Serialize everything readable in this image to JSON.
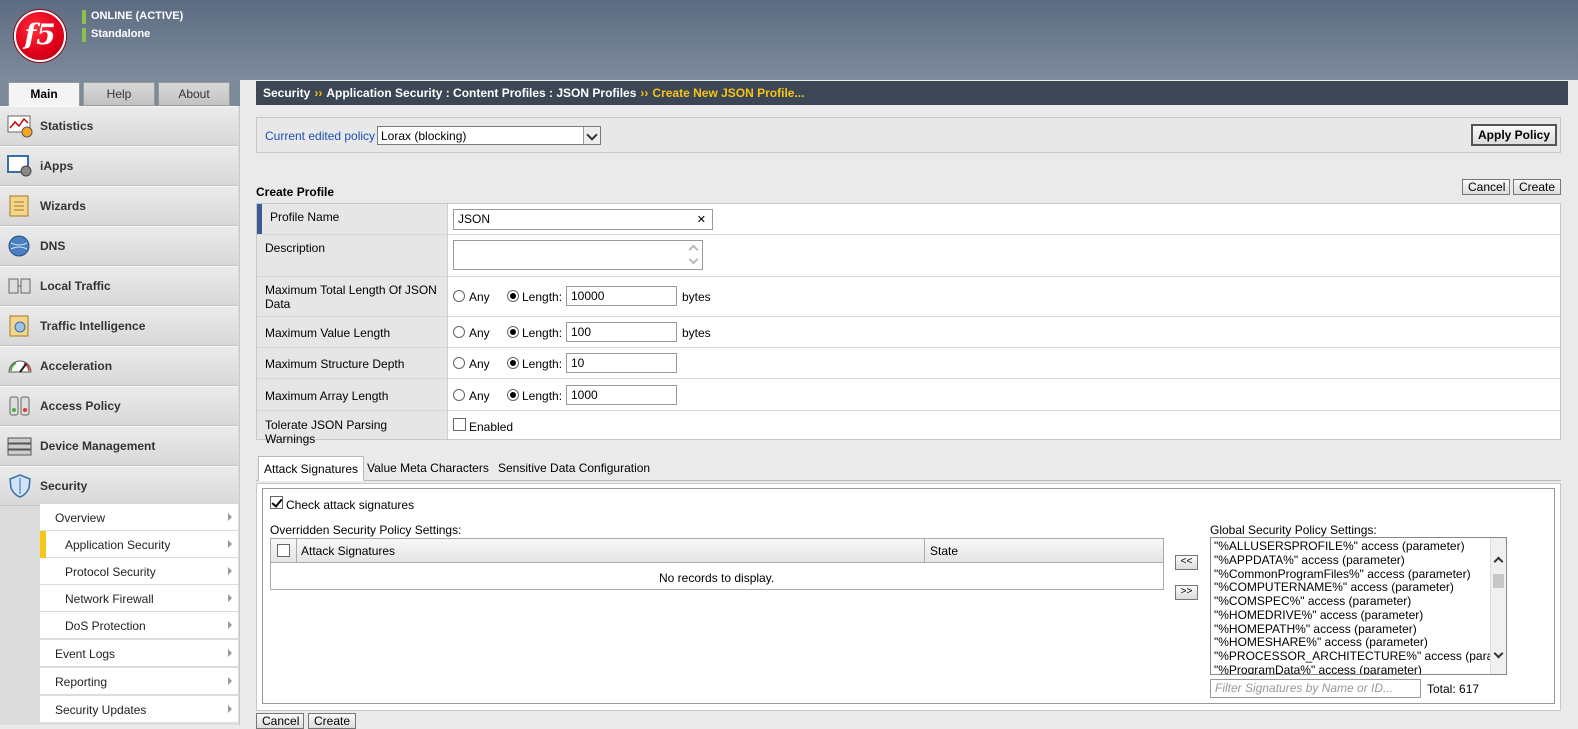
{
  "banner": {
    "logo_text": "f5",
    "status": "ONLINE (ACTIVE)",
    "mode": "Standalone"
  },
  "tabs": [
    "Main",
    "Help",
    "About"
  ],
  "nav": {
    "items": [
      {
        "label": "Statistics",
        "icon": "statistics-icon"
      },
      {
        "label": "iApps",
        "icon": "iapps-icon"
      },
      {
        "label": "Wizards",
        "icon": "wizards-icon"
      },
      {
        "label": "DNS",
        "icon": "dns-globe-icon"
      },
      {
        "label": "Local Traffic",
        "icon": "local-traffic-icon"
      },
      {
        "label": "Traffic Intelligence",
        "icon": "traffic-intelligence-icon"
      },
      {
        "label": "Acceleration",
        "icon": "acceleration-gauge-icon"
      },
      {
        "label": "Access Policy",
        "icon": "access-policy-icon"
      },
      {
        "label": "Device Management",
        "icon": "device-management-icon"
      },
      {
        "label": "Security",
        "icon": "security-shield-icon"
      }
    ],
    "security_sub": [
      {
        "label": "Overview"
      },
      {
        "label": "Application Security"
      },
      {
        "label": "Protocol Security"
      },
      {
        "label": "Network Firewall"
      },
      {
        "label": "DoS Protection"
      },
      {
        "label": "Event Logs"
      },
      {
        "label": "Reporting"
      },
      {
        "label": "Security Updates"
      }
    ]
  },
  "breadcrumb": {
    "part1": "Security",
    "sep": "››",
    "part2": "Application Security : Content Profiles : JSON Profiles",
    "current": "Create New JSON Profile..."
  },
  "policy": {
    "label": "Current edited policy",
    "selected": "Lorax (blocking)",
    "apply_label": "Apply Policy"
  },
  "form": {
    "title": "Create Profile",
    "cancel_label": "Cancel",
    "create_label": "Create",
    "profile_name_label": "Profile Name",
    "profile_name_value": "JSON",
    "clear_glyph": "✕",
    "description_label": "Description",
    "any_label": "Any",
    "length_label": "Length:",
    "bytes_label": "bytes",
    "rows": [
      {
        "label": "Maximum Total Length Of JSON Data",
        "value": "10000",
        "unit": true
      },
      {
        "label": "Maximum Value Length",
        "value": "100",
        "unit": true
      },
      {
        "label": "Maximum Structure Depth",
        "value": "10",
        "unit": false
      },
      {
        "label": "Maximum Array Length",
        "value": "1000",
        "unit": false
      }
    ],
    "tolerate_label": "Tolerate JSON Parsing Warnings",
    "enabled_label": "Enabled"
  },
  "subtabs": [
    "Attack Signatures",
    "Value Meta Characters",
    "Sensitive Data Configuration"
  ],
  "signatures": {
    "check_label": "Check attack signatures",
    "overridden_label": "Overridden Security Policy Settings:",
    "col_signatures": "Attack Signatures",
    "col_state": "State",
    "no_records": "No records to display.",
    "move_left": "<<",
    "move_right": ">>",
    "global_label": "Global Security Policy Settings:",
    "global_items": [
      "\"%ALLUSERSPROFILE%\" access (parameter)",
      "\"%APPDATA%\" access (parameter)",
      "\"%CommonProgramFiles%\" access (parameter)",
      "\"%COMPUTERNAME%\" access (parameter)",
      "\"%COMSPEC%\" access (parameter)",
      "\"%HOMEDRIVE%\" access (parameter)",
      "\"%HOMEPATH%\" access (parameter)",
      "\"%HOMESHARE%\" access (parameter)",
      "\"%PROCESSOR_ARCHITECTURE%\" access (para",
      "\"%ProgramData%\" access (parameter)"
    ],
    "filter_placeholder": "Filter Signatures by Name or ID...",
    "total_label": "Total: 617"
  },
  "bottom": {
    "cancel_label": "Cancel",
    "create_label": "Create"
  }
}
